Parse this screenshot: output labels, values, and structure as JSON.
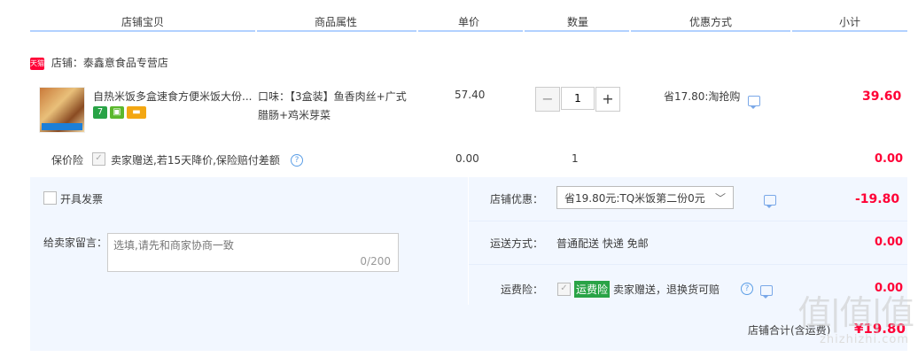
{
  "header": {
    "col_shop_item": "店铺宝贝",
    "col_attrs": "商品属性",
    "col_price": "单价",
    "col_qty": "数量",
    "col_discount": "优惠方式",
    "col_subtotal": "小计"
  },
  "shop": {
    "badge": "天猫",
    "name": "店铺：泰鑫意食品专营店"
  },
  "item": {
    "title": "自热米饭多盒速食方便米饭大份...",
    "badge_7": "7",
    "attrs_line1": "口味：【3盒装】鱼香肉丝+广式",
    "attrs_line2": "腊肠+鸡米芽菜",
    "price": "57.40",
    "quantity": "1",
    "discount": "省17.80:淘抢购",
    "subtotal": "39.60",
    "minus_label": "−",
    "plus_label": "+"
  },
  "insurance": {
    "label": "保价险",
    "checkbox_mark": "✓",
    "text": "卖家赠送,若15天降价,保险赔付差额",
    "help": "?",
    "price": "0.00",
    "quantity": "1",
    "subtotal": "0.00"
  },
  "invoice": {
    "label": "开具发票"
  },
  "message": {
    "label": "给卖家留言：",
    "placeholder": "选填,请先和商家协商一致",
    "count": "0/200"
  },
  "shop_discount": {
    "label": "店铺优惠：",
    "selected": "省19.80元:TQ米饭第二份0元",
    "chevron": "﹀",
    "amount": "-19.80"
  },
  "shipping": {
    "label": "运送方式：",
    "value": "普通配送 快递 免邮",
    "amount": "0.00"
  },
  "shipping_insurance": {
    "label": "运费险：",
    "checkbox_mark": "✓",
    "tag": "运费险",
    "text": "卖家赠送，退换货可赔",
    "help": "?",
    "amount": "0.00"
  },
  "total": {
    "label": "店铺合计(含运费)",
    "amount": "¥19.80"
  },
  "watermark": {
    "main": "值|值|值",
    "sub": "zhizhizhi.com"
  },
  "colors": {
    "accent_red": "#ff0036",
    "header_line": "#b2d1ff",
    "panel_bg": "#f2f7ff"
  }
}
